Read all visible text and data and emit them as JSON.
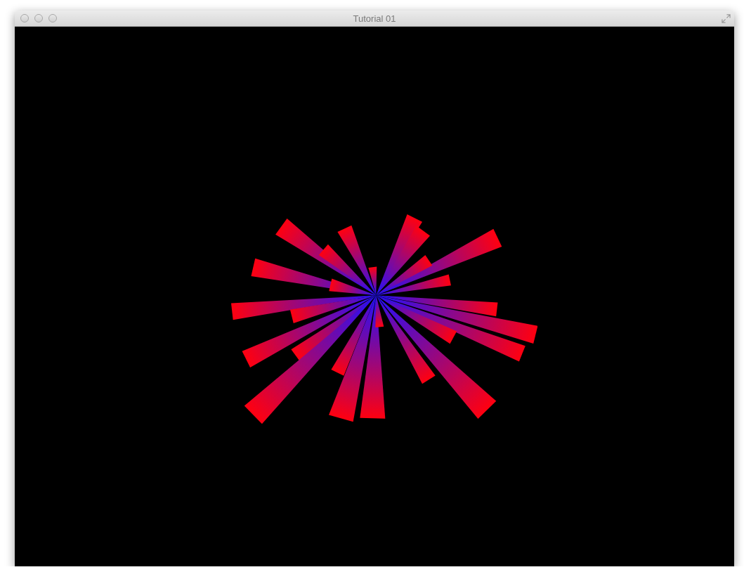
{
  "window": {
    "title": "Tutorial 01"
  }
}
